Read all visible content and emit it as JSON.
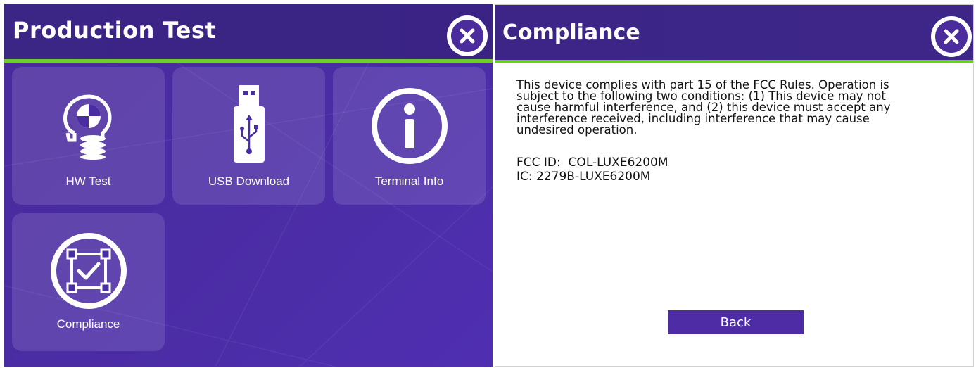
{
  "production_test": {
    "title": "Production Test",
    "tiles": [
      {
        "label": "HW Test",
        "icon": "head-gears-icon"
      },
      {
        "label": "USB Download",
        "icon": "usb-drive-icon"
      },
      {
        "label": "Terminal Info",
        "icon": "info-icon"
      },
      {
        "label": "Compliance",
        "icon": "compliance-check-icon"
      }
    ],
    "close_icon": "close-icon"
  },
  "compliance": {
    "title": "Compliance",
    "text_lines": [
      "This device complies with part 15 of the FCC Rules. Operation is",
      "subject to the following two conditions: (1) This device may not",
      "cause harmful interference, and (2) this device must accept any",
      "interference received, including interference that may cause",
      "undesired operation."
    ],
    "fcc_id": "FCC ID:  COL-LUXE6200M",
    "ic": "IC: 2279B-LUXE6200M",
    "back_label": "Back",
    "close_icon": "close-icon"
  },
  "colors": {
    "header_purple": "#3b2585",
    "panel_purple": "#4a2ca3",
    "accent_green": "#6fcb2e",
    "button_purple": "#4d2ca6"
  }
}
